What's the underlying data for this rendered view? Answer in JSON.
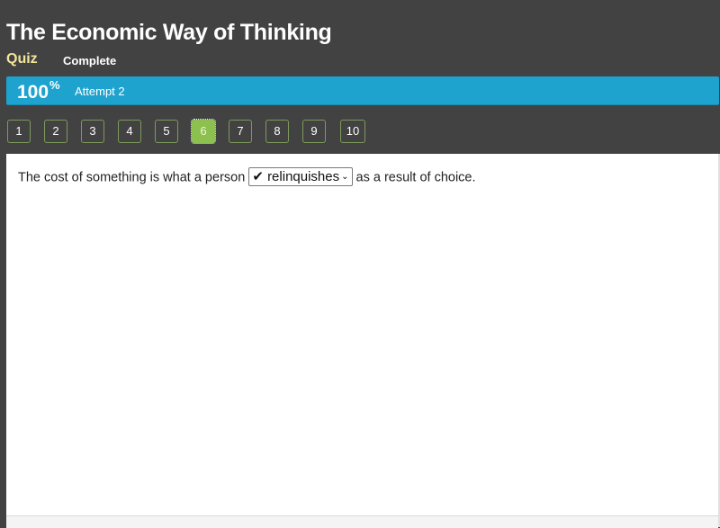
{
  "header": {
    "title": "The Economic Way of Thinking",
    "quiz_label": "Quiz",
    "status": "Complete"
  },
  "score": {
    "value": "100",
    "unit": "%",
    "attempt": "Attempt 2"
  },
  "question_nav": {
    "items": [
      "1",
      "2",
      "3",
      "4",
      "5",
      "6",
      "7",
      "8",
      "9",
      "10"
    ],
    "active": "6"
  },
  "question": {
    "before": "The cost of something is what a person",
    "answer_mark": "✔",
    "selected_answer": "relinquishes",
    "after": "as a result of choice."
  },
  "colors": {
    "background": "#424242",
    "score_bar": "#1ea3cf",
    "quiz_label": "#f2e49a",
    "active_question": "#8cc04f",
    "question_border": "#7d9a5a"
  }
}
